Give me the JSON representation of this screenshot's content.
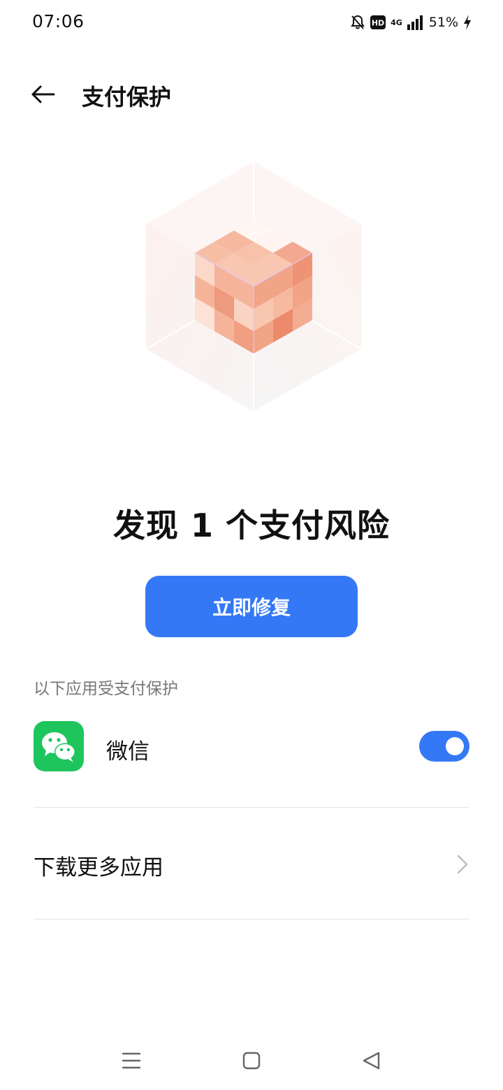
{
  "status_bar": {
    "time": "07:06",
    "network": "4G",
    "battery": "51%",
    "icons": [
      "bell-off-icon",
      "hd-icon",
      "signal-icon",
      "battery-charging-icon"
    ]
  },
  "header": {
    "title": "支付保护",
    "back_icon": "back-arrow-icon"
  },
  "main": {
    "risk_title": "发现 1 个支付风险",
    "fix_button_label": "立即修复",
    "section_label": "以下应用受支付保护",
    "apps": [
      {
        "name": "微信",
        "icon": "wechat-icon",
        "protected": true
      }
    ],
    "download_more_label": "下载更多应用"
  },
  "colors": {
    "accent": "#3478f6",
    "wechat_green": "#1ec55c",
    "cube_orange": "#f4a98c"
  },
  "nav_bar": {
    "buttons": [
      "menu-icon",
      "home-icon",
      "back-triangle-icon"
    ]
  }
}
